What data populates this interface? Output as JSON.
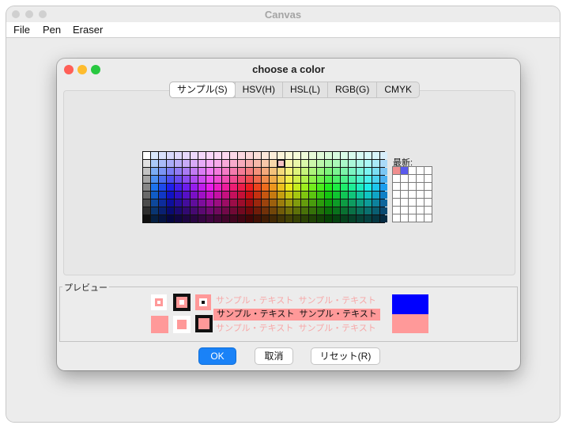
{
  "window": {
    "title": "Canvas"
  },
  "menu": {
    "items": [
      "File",
      "Pen",
      "Eraser"
    ]
  },
  "dialog": {
    "title": "choose a color",
    "tabs": [
      "サンプル(S)",
      "HSV(H)",
      "HSL(L)",
      "RGB(G)",
      "CMYK"
    ],
    "active_tab": "サンプル(S)",
    "recent_label": "最新:",
    "recent_colors": [
      "#f08e8e",
      "#5a5aee"
    ],
    "preview": {
      "label": "プレビュー",
      "sample_text": "サンプル・テキスト",
      "selected_color": "#ff9999",
      "previous_color": "#0000ff"
    },
    "buttons": {
      "ok": "OK",
      "cancel": "取消",
      "reset": "リセット(R)"
    }
  },
  "colors": {
    "accent": "#1a82f7",
    "traffic_close": "#ff5f57",
    "traffic_minimize": "#febc2e",
    "traffic_zoom": "#28c840"
  }
}
